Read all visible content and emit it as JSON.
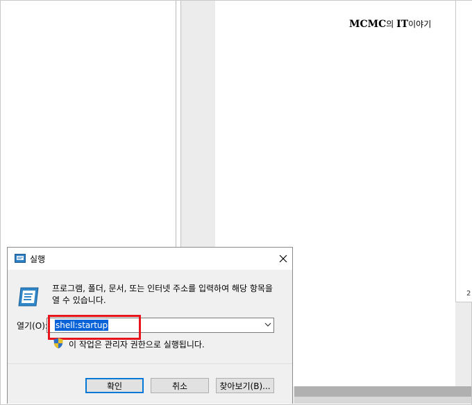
{
  "watermark": {
    "part1": "MCMC",
    "part2": "의 ",
    "part3": "IT",
    "part4": "이야기"
  },
  "page_number": "2",
  "dialog": {
    "title": "실행",
    "description": "프로그램, 폴더, 문서, 또는 인터넷 주소를 입력하여 해당 항목을 열 수 있습니다.",
    "open_label": "열기(O):",
    "input_value": "shell:startup",
    "admin_note": "이 작업은 관리자 권한으로 실행됩니다.",
    "buttons": {
      "ok": "확인",
      "cancel": "취소",
      "browse": "찾아보기(B)..."
    }
  },
  "colors": {
    "highlight": "#e8141c",
    "selection": "#0a64d8",
    "accent": "#0078d7"
  }
}
